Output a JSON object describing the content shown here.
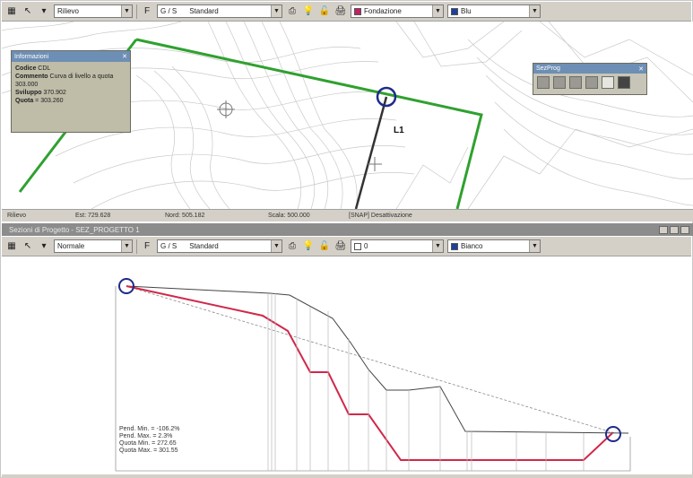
{
  "top_toolbar": {
    "layer": "Rilievo",
    "style_buttons": "G / S",
    "style": "Standard",
    "category": "Fondazione",
    "color": "Blu",
    "color_hex": "#1f3f9a",
    "category_color_hex": "#c22060"
  },
  "map": {
    "info_panel": {
      "title": "Informazioni",
      "lines": [
        {
          "key": "Codice",
          "value": "CDL"
        },
        {
          "key": "Commento",
          "value": "Curva di livello a quota 303.000"
        },
        {
          "key": "Sviluppo",
          "value": "370.902"
        },
        {
          "key": "Quota",
          "value": "303.260"
        }
      ]
    },
    "floating_toolbar_title": "SezProg",
    "line_label": "L1"
  },
  "status": {
    "mode": "Rilievo",
    "east": "Est: 729.628",
    "north": "Nord: 505.182",
    "scale": "Scala: 500.000",
    "snap": "[SNAP] Desattivazione"
  },
  "section_window": {
    "title": "Sezioni di Progetto - SEZ_PROGETTO 1",
    "toolbar": {
      "layer": "Normale",
      "style_buttons": "G / S",
      "style": "Standard",
      "fill_value": "0",
      "color": "Bianco"
    }
  },
  "profile": {
    "stats": [
      "Pend. Min. = -106.2%",
      "Pend. Max. = 2.3%",
      "Quota Min. = 272.65",
      "Quota Max. = 301.55"
    ]
  },
  "colors": {
    "terrain_line": "#444444",
    "project_line": "#d1284a",
    "marker": "#1f2a8a",
    "map_boundary": "#2fa12f"
  }
}
